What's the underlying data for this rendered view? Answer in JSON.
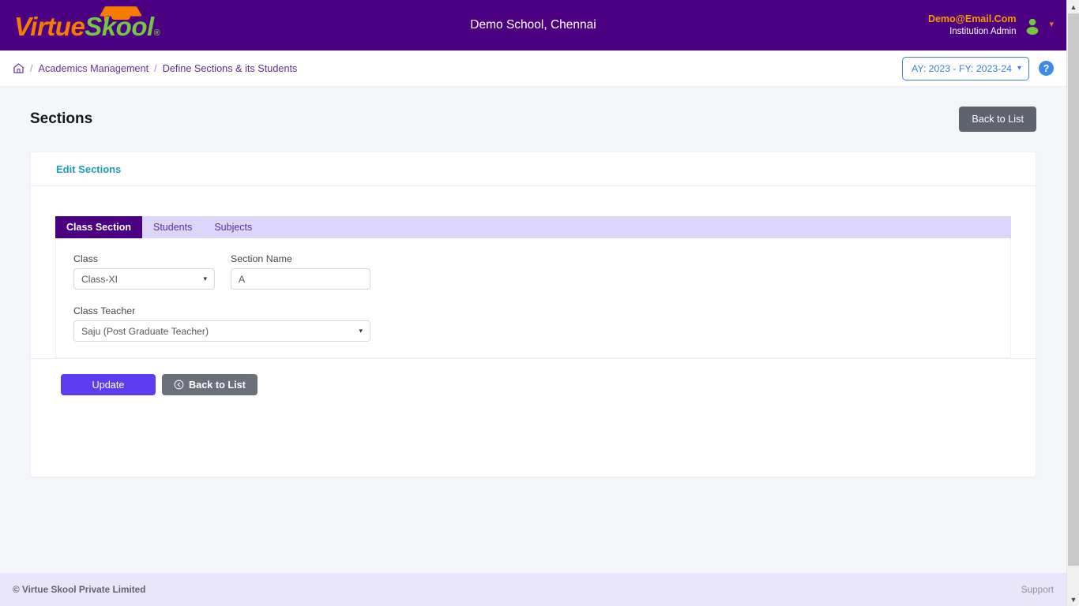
{
  "header": {
    "logo": {
      "part1": "Virtue",
      "part2": "Skool",
      "registered": "®",
      "icon": "graduation-cap-icon"
    },
    "school_title": "Demo School, Chennai",
    "user": {
      "email": "Demo@Email.Com",
      "role": "Institution Admin",
      "avatar_icon": "user-avatar-icon",
      "caret_icon": "chevron-down-icon"
    },
    "brand_purple": "#4b0082",
    "email_orange": "#ff9800",
    "logo_green": "#76c442"
  },
  "breadcrumb": {
    "home_icon": "home-icon",
    "separator": "/",
    "items": [
      {
        "label": "Academics Management"
      },
      {
        "label": "Define Sections & its Students"
      }
    ],
    "academic_year": {
      "label": "AY: 2023 - FY: 2023-24",
      "caret": "⌄"
    },
    "help_icon": "help-circle-icon",
    "help_glyph": "?",
    "link_color": "#6b2fa0",
    "ay_color": "#3d7fe0"
  },
  "page": {
    "title": "Sections",
    "back_to_list_top": "Back to List"
  },
  "card": {
    "title": "Edit Sections",
    "title_color": "#1e9db4",
    "tabs": [
      {
        "label": "Class Section",
        "active": true
      },
      {
        "label": "Students",
        "active": false
      },
      {
        "label": "Subjects",
        "active": false
      }
    ],
    "form": {
      "fields": [
        {
          "label": "Class",
          "value": "Class-XI",
          "type": "select"
        },
        {
          "label": "Section Name",
          "value": "A",
          "type": "text",
          "placeholder": ""
        },
        {
          "label": "Class Teacher",
          "value": "Saju (Post Graduate Teacher)",
          "type": "select"
        }
      ]
    },
    "actions": {
      "update": "Update",
      "back_to_list": "Back to List",
      "back_icon": "circle-arrow-left-icon",
      "update_color": "#5c3ef0"
    }
  },
  "footer": {
    "copyright": "© Virtue Skool Private Limited",
    "support": "Support",
    "background": "#e9e5fb"
  },
  "scrollbar": {
    "up_arrow": "chevron-up-icon",
    "down_arrow": "chevron-down-icon"
  }
}
